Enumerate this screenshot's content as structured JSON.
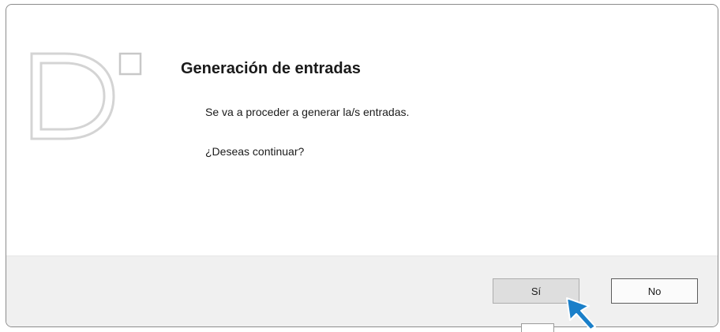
{
  "dialog": {
    "title": "Generación de entradas",
    "message_line1": "Se va a proceder a generar la/s entradas.",
    "message_line2": "¿Deseas continuar?",
    "logo_icon": "app-logo-d-icon"
  },
  "buttons": {
    "yes_label": "Sí",
    "no_label": "No"
  },
  "cursor": {
    "icon": "arrow-cursor-icon",
    "color": "#1a7fc9"
  }
}
